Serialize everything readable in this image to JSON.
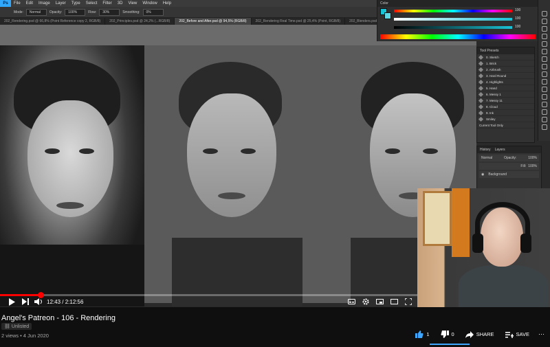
{
  "photoshop": {
    "logo": "Ps",
    "menu": [
      "File",
      "Edit",
      "Image",
      "Layer",
      "Type",
      "Select",
      "Filter",
      "3D",
      "View",
      "Window",
      "Help"
    ],
    "options": {
      "mode_label": "Mode:",
      "mode_value": "Normal",
      "opacity_label": "Opacity:",
      "opacity_value": "100%",
      "flow_label": "Flow:",
      "flow_value": "30%",
      "smoothing_label": "Smoothing:",
      "smoothing_value": "0%"
    },
    "tabs": [
      "202_Rendering.psd @ 66,8% (Point Reference copy 2, RGB/8)",
      "202_Principles.psd @ 24,2% (...RGB/8)",
      "202_Before and After.psd @ 94,5% (RGB/8)",
      "202_Rendering Real Time.psd @ 25,4% (Point, RGB/8)",
      "202_Blenders.psd @ ..."
    ],
    "active_tab_index": 2,
    "color_panel": {
      "title": "Color",
      "values": [
        "100",
        "100",
        "100"
      ],
      "foreground": "#19c3d6",
      "background": "#5fd6e3"
    },
    "tool_presets": {
      "title": "Tool Presets",
      "items": [
        "0. Sketch",
        "1. Brick",
        "2. Airbrush",
        "3. Hard Round",
        "4. Highlights",
        "5. Hand",
        "6. Messy 1",
        "7. Messy 11",
        "8. Cloud",
        "9. Ink",
        "Smiley"
      ],
      "footer": "Current Tool Only"
    },
    "layers": {
      "tabs": [
        "History",
        "Layers"
      ],
      "blend": "Normal",
      "opacity_label": "Opacity:",
      "opacity": "100%",
      "fill_label": "Fill:",
      "fill": "100%",
      "layer_name": "Background"
    }
  },
  "player": {
    "progress_fraction": 0.098,
    "time_current": "12:43",
    "time_sep": " / ",
    "time_total": "2:12:56"
  },
  "video": {
    "title": "Angel's Patreon - 106 - Rendering",
    "badge": "Unlisted",
    "meta": "2 views • 4 Jun 2020",
    "likes": "1",
    "dislikes": "0",
    "share": "SHARE",
    "save": "SAVE",
    "accent": "#3ea6ff",
    "progress_color": "#ff0000"
  }
}
